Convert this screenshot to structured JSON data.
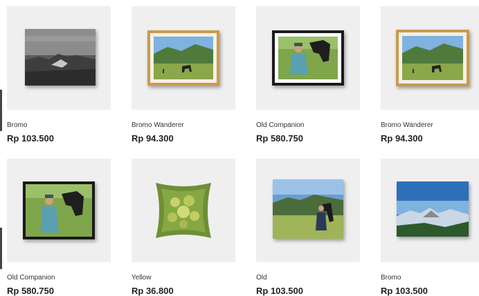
{
  "products": [
    {
      "name": "Bromo",
      "price": "Rp 103.500",
      "art": "mono-landscape"
    },
    {
      "name": "Bromo Wanderer",
      "price": "Rp 94.300",
      "art": "horse-meadow-gold-frame"
    },
    {
      "name": "Old Companion",
      "price": "Rp 580.750",
      "art": "man-with-horse-black-frame"
    },
    {
      "name": "Bromo Wanderer",
      "price": "Rp 94.300",
      "art": "horse-meadow-gold-frame"
    },
    {
      "name": "Old Companion",
      "price": "Rp 580.750",
      "art": "man-with-horse-black-frame"
    },
    {
      "name": "Yellow",
      "price": "Rp 36.800",
      "art": "flower-cushion"
    },
    {
      "name": "Old",
      "price": "Rp 103.500",
      "art": "man-with-horse-canvas"
    },
    {
      "name": "Bromo",
      "price": "Rp 103.500",
      "art": "volcano-canvas"
    }
  ]
}
